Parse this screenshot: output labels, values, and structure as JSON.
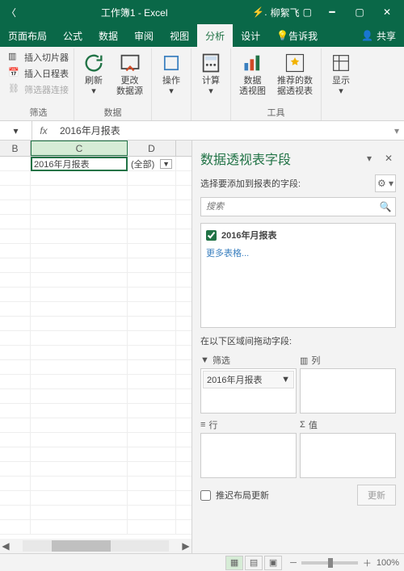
{
  "titlebar": {
    "title": "工作簿1 - Excel",
    "user_prefix": "⚡.",
    "user": "柳絮飞"
  },
  "tabs": [
    "页面布局",
    "公式",
    "数据",
    "审阅",
    "视图",
    "分析",
    "设计",
    "告诉我"
  ],
  "active_tab": 5,
  "share": "共享",
  "ribbon": {
    "g1": {
      "items": [
        "插入切片器",
        "插入日程表",
        "筛选器连接"
      ],
      "label": "筛选"
    },
    "g2": {
      "b1": "刷新",
      "b2": "更改\n数据源",
      "label": "数据"
    },
    "g3": {
      "b": "操作"
    },
    "g4": {
      "b": "计算"
    },
    "g5": {
      "b1": "数据\n透视图",
      "b2": "推荐的数\n据透视表",
      "label": "工具"
    },
    "g6": {
      "b": "显示"
    }
  },
  "formula": {
    "value": "2016年月报表"
  },
  "sheet": {
    "cols": [
      "B",
      "C",
      "D"
    ],
    "c2": "2016年月报表",
    "d2": "(全部)"
  },
  "pane": {
    "title": "数据透视表字段",
    "subtitle": "选择要添加到报表的字段:",
    "search_placeholder": "搜索",
    "field": "2016年月报表",
    "more": "更多表格...",
    "areas_label": "在以下区域间拖动字段:",
    "filter": "筛选",
    "columns": "列",
    "rows": "行",
    "values": "值",
    "filter_item": "2016年月报表",
    "defer": "推迟布局更新",
    "update": "更新"
  },
  "status": {
    "zoom": "100%"
  }
}
